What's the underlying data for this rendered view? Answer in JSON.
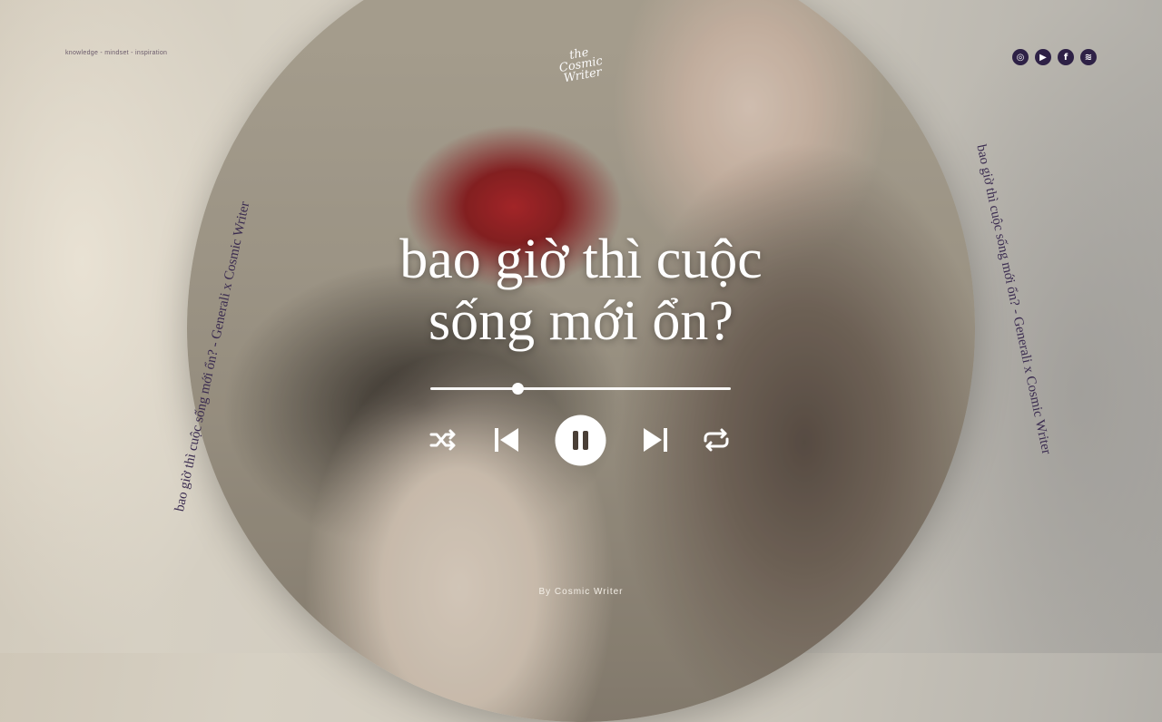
{
  "page": {
    "tagline": "knowledge - mindset - inspiration",
    "logo_text": "the Cosmic Writer",
    "title_line1": "bao giờ thì cuộc",
    "title_line2": "sống mới ổn?",
    "byline": "By Cosmic Writer",
    "side_text": "bao giờ thì cuộc sống mới ổn? - Generali x Cosmic Writer"
  },
  "social": [
    {
      "name": "instagram-icon",
      "glyph": "◎"
    },
    {
      "name": "youtube-icon",
      "glyph": "▶"
    },
    {
      "name": "facebook-icon",
      "glyph": "f"
    },
    {
      "name": "spotify-icon",
      "glyph": "≋"
    }
  ],
  "player": {
    "progress": 0.29,
    "state": "playing"
  },
  "colors": {
    "icon_bg": "#2e2146",
    "title": "#ffffff",
    "accent_flower": "#b3262a"
  }
}
